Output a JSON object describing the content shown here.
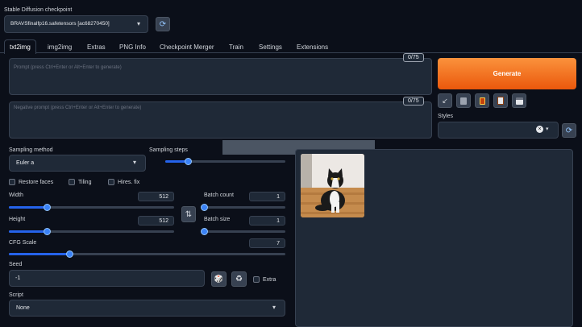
{
  "checkpoint": {
    "label": "Stable Diffusion checkpoint",
    "value": "BRAVSfinalfp16.safetensors [ac68270450]",
    "refresh_icon": "refresh-icon"
  },
  "tabs": [
    "txt2img",
    "img2img",
    "Extras",
    "PNG Info",
    "Checkpoint Merger",
    "Train",
    "Settings",
    "Extensions"
  ],
  "prompt": {
    "placeholder": "Prompt (press Ctrl+Enter or Alt+Enter to generate)",
    "counter": "0/75"
  },
  "negative_prompt": {
    "placeholder": "Negative prompt (press Ctrl+Enter or Alt+Enter to generate)",
    "counter": "0/75"
  },
  "generate_label": "Generate",
  "styles": {
    "label": "Styles",
    "clear_glyph": "×",
    "chevron_glyph": "▾"
  },
  "tool_icons": [
    "arrow-in-icon",
    "trash-icon",
    "card-icon",
    "clipboard-icon",
    "save-icon"
  ],
  "sampling": {
    "method_label": "Sampling method",
    "method_value": "Euler a",
    "steps_label": "Sampling steps",
    "steps_fraction": 0.19
  },
  "checks": {
    "restore_faces": "Restore faces",
    "tiling": "Tiling",
    "hires_fix": "Hires. fix"
  },
  "width": {
    "label": "Width",
    "value": "512",
    "fraction": 0.23
  },
  "height": {
    "label": "Height",
    "value": "512",
    "fraction": 0.23
  },
  "batch_count": {
    "label": "Batch count",
    "value": "1",
    "fraction": 0.0
  },
  "batch_size": {
    "label": "Batch size",
    "value": "1",
    "fraction": 0.0
  },
  "swap_icon": "⇅",
  "cfg": {
    "label": "CFG Scale",
    "value": "7",
    "fraction": 0.22
  },
  "seed": {
    "label": "Seed",
    "value": "-1",
    "extra_label": "Extra",
    "dice_glyph": "🎲",
    "recycle_glyph": "♻"
  },
  "script": {
    "label": "Script",
    "value": "None"
  },
  "colors": {
    "accent": "#f97316",
    "slider": "#3b82f6",
    "bg": "#0b0f19",
    "panel": "#1f2937"
  }
}
